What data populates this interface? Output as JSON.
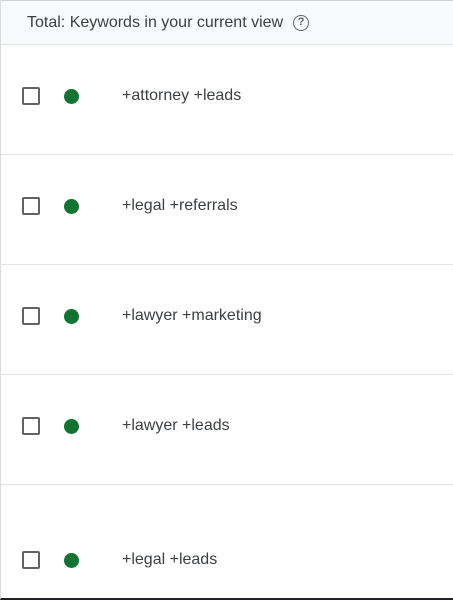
{
  "header": {
    "total_label": "Total: Keywords in your current view",
    "help_icon": "help-circle-icon",
    "help_glyph": "?"
  },
  "status_color": "#137333",
  "rows": [
    {
      "keyword": "+attorney +leads",
      "status": "eligible"
    },
    {
      "keyword": "+legal +referrals",
      "status": "eligible"
    },
    {
      "keyword": "+lawyer +marketing",
      "status": "eligible"
    },
    {
      "keyword": "+lawyer +leads",
      "status": "eligible"
    },
    {
      "keyword": "+legal +leads",
      "status": "eligible"
    }
  ]
}
